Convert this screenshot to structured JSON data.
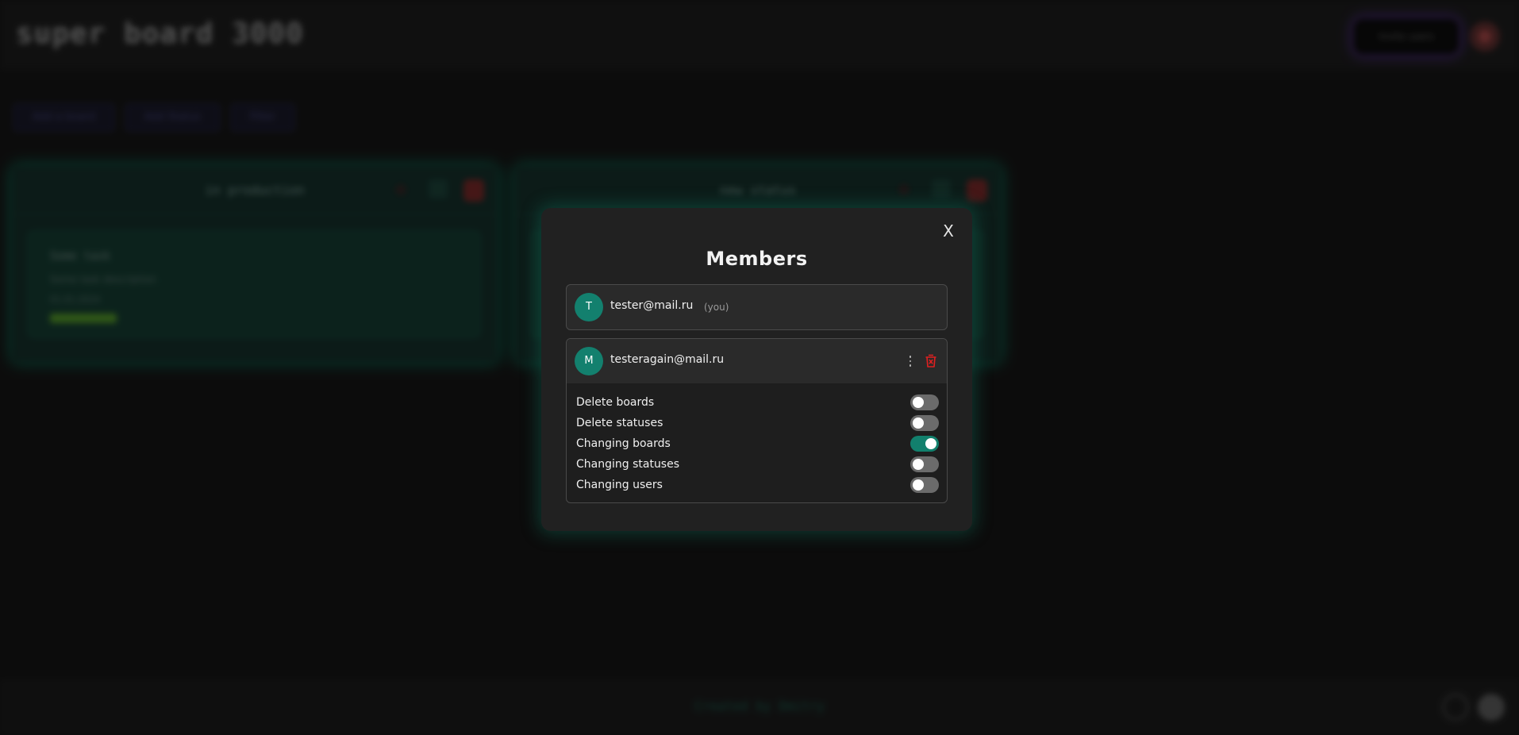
{
  "app": {
    "title": "super board 3000",
    "invite_label": "Invite users"
  },
  "toolbar": {
    "chips": [
      "Add a board",
      "Add Status",
      "Filter"
    ]
  },
  "columns": [
    {
      "title": "in production",
      "card": {
        "title": "Some task",
        "description": "Some task description",
        "date": "01.01.2024"
      }
    },
    {
      "title": "new status",
      "card": {
        "title": "",
        "description": "",
        "date": ""
      }
    }
  ],
  "footer": {
    "text": "Created by Dmitry"
  },
  "modal": {
    "title": "Members",
    "close_label": "X",
    "members": [
      {
        "initial": "T",
        "email": "tester@mail.ru",
        "you_label": "(you)"
      },
      {
        "initial": "M",
        "email": "testeragain@mail.ru",
        "permissions": [
          {
            "label": "Delete boards",
            "enabled": false
          },
          {
            "label": "Delete statuses",
            "enabled": false
          },
          {
            "label": "Changing boards",
            "enabled": true
          },
          {
            "label": "Changing statuses",
            "enabled": false
          },
          {
            "label": "Changing users",
            "enabled": false
          }
        ]
      }
    ]
  },
  "colors": {
    "accent": "#12806d",
    "danger": "#e02020",
    "background": "#171717",
    "modal": "#212121"
  }
}
